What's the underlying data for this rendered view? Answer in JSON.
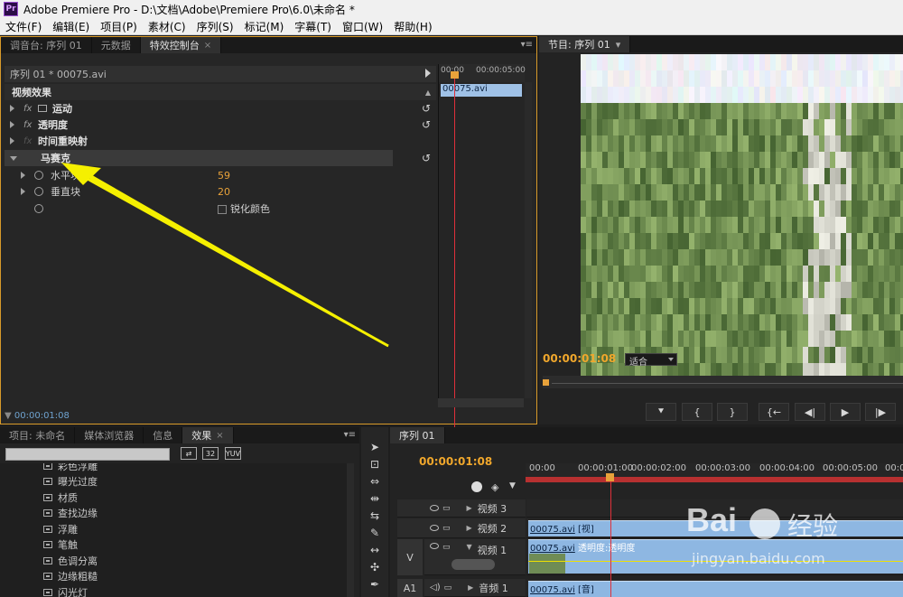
{
  "app": {
    "title": "Adobe Premiere Pro - D:\\文档\\Adobe\\Premiere Pro\\6.0\\未命名 *",
    "logo": "Pr"
  },
  "menu": [
    "文件(F)",
    "编辑(E)",
    "项目(P)",
    "素材(C)",
    "序列(S)",
    "标记(M)",
    "字幕(T)",
    "窗口(W)",
    "帮助(H)"
  ],
  "effect_panel": {
    "tabs": [
      {
        "label": "调音台: 序列 01"
      },
      {
        "label": "元数据"
      },
      {
        "label": "特效控制台",
        "close": "×"
      }
    ],
    "header": "序列 01 * 00075.avi",
    "video_effects": "视频效果",
    "effects": {
      "motion": "运动",
      "opacity": "透明度",
      "time_remap": "时间重映射",
      "mosaic": "马赛克"
    },
    "params": {
      "horizontal_label": "水平块",
      "horizontal_value": "59",
      "vertical_label": "垂直块",
      "vertical_value": "20",
      "sharpen_label": "锐化颜色"
    },
    "fx_glyph": "fx",
    "reset_glyph": "↺",
    "timeline": {
      "t0": "00:00",
      "t1": "00:00:05:00",
      "clip": "00075.avi"
    },
    "footer_tc": "00:00:01:08"
  },
  "program_panel": {
    "tab": "节目: 序列 01",
    "timecode": "00:00:01:08",
    "fit": "适合",
    "buttons": [
      "⯆",
      "{",
      "}",
      "{←",
      "◀|",
      "▶",
      "|▶"
    ]
  },
  "project_panel": {
    "tabs": [
      {
        "label": "项目: 未命名"
      },
      {
        "label": "媒体浏览器"
      },
      {
        "label": "信息"
      },
      {
        "label": "效果",
        "close": "×"
      }
    ],
    "icons": [
      "32",
      "YUV"
    ],
    "items": [
      "彩色浮雕",
      "曝光过度",
      "材质",
      "查找边缘",
      "浮雕",
      "笔触",
      "色调分离",
      "边缘粗糙",
      "闪光灯"
    ]
  },
  "timeline_panel": {
    "tab": "序列 01",
    "timecode": "00:00:01:08",
    "ruler": [
      "00:00",
      "00:00:01:00",
      "00:00:02:00",
      "00:00:03:00",
      "00:00:04:00",
      "00:00:05:00",
      "00:0"
    ],
    "tracks": {
      "v3": "视频 3",
      "v2": "视频 2",
      "v1": "视频 1",
      "a1": "音频 1",
      "v_label": "V",
      "a_label": "A1"
    },
    "clips": {
      "v2": "00075.avi",
      "v2_tag": "[视]",
      "v1": "00075.avi",
      "v1_tag": "透明度:透明度",
      "a1": "00075.avi",
      "a1_tag": "[音]"
    }
  },
  "watermark": {
    "brand": "Bai",
    "brand2": "经验",
    "url": "jingyan.baidu.com"
  },
  "colors": {
    "accent_orange": "#f0a72c",
    "playhead_red": "#e0303a",
    "clip_blue": "#8eb7e2",
    "arrow_yellow": "#f5f000"
  }
}
